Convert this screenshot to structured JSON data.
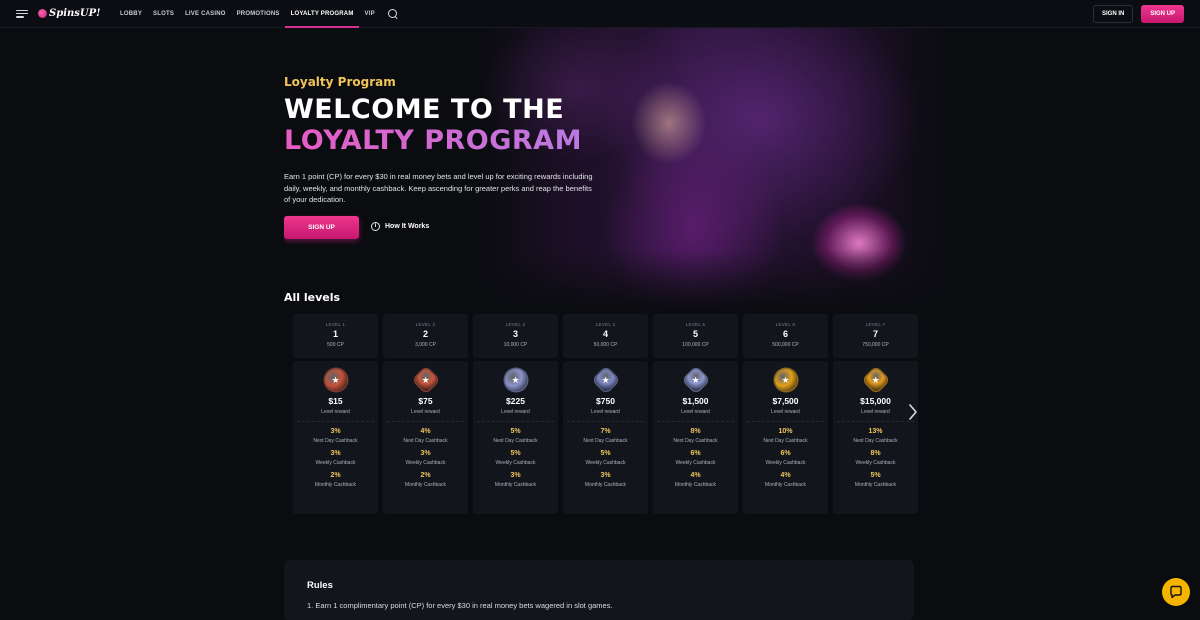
{
  "brand": {
    "name": "SpinsUP!"
  },
  "nav": {
    "items": [
      {
        "label": "LOBBY"
      },
      {
        "label": "SLOTS"
      },
      {
        "label": "LIVE CASINO"
      },
      {
        "label": "PROMOTIONS"
      },
      {
        "label": "LOYALTY PROGRAM",
        "active": true
      },
      {
        "label": "VIP"
      }
    ],
    "sign_in": "SIGN IN",
    "sign_up": "SIGN UP"
  },
  "hero": {
    "eyebrow": "Loyalty Program",
    "title_line1": "WELCOME TO THE",
    "title_line2": "LOYALTY PROGRAM",
    "description": "Earn 1 point (CP) for every $30 in real money bets and level up for exciting rewards including daily, weekly, and monthly cashback. Keep ascending for greater perks and reap the benefits of your dedication.",
    "cta": "SIGN UP",
    "how_it_works": "How It Works"
  },
  "levels": {
    "title": "All levels",
    "reward_label": "Level reward",
    "next_day_label": "Next Day Cashback",
    "weekly_label": "Weekly Cashback",
    "monthly_label": "Monthly Cashback",
    "items": [
      {
        "label": "LEVEL 1",
        "num": "1",
        "cp": "500 CP",
        "reward": "$15",
        "next_day": "3%",
        "weekly": "3%",
        "monthly": "2%",
        "medal_color": "#c4533a"
      },
      {
        "label": "LEVEL 2",
        "num": "2",
        "cp": "3,000 CP",
        "reward": "$75",
        "next_day": "4%",
        "weekly": "3%",
        "monthly": "2%",
        "medal_color": "#c8573c"
      },
      {
        "label": "LEVEL 3",
        "num": "3",
        "cp": "10,000 CP",
        "reward": "$225",
        "next_day": "5%",
        "weekly": "5%",
        "monthly": "3%",
        "medal_color": "#8c93c9"
      },
      {
        "label": "LEVEL 4",
        "num": "4",
        "cp": "50,000 CP",
        "reward": "$750",
        "next_day": "7%",
        "weekly": "5%",
        "monthly": "3%",
        "medal_color": "#7e89c6"
      },
      {
        "label": "LEVEL 5",
        "num": "5",
        "cp": "100,000 CP",
        "reward": "$1,500",
        "next_day": "8%",
        "weekly": "6%",
        "monthly": "4%",
        "medal_color": "#8f98d0"
      },
      {
        "label": "LEVEL 6",
        "num": "6",
        "cp": "500,000 CP",
        "reward": "$7,500",
        "next_day": "10%",
        "weekly": "6%",
        "monthly": "4%",
        "medal_color": "#e0a019"
      },
      {
        "label": "LEVEL 7",
        "num": "7",
        "cp": "750,000 CP",
        "reward": "$15,000",
        "next_day": "13%",
        "weekly": "8%",
        "monthly": "5%",
        "medal_color": "#e39c1c"
      }
    ]
  },
  "rules": {
    "title": "Rules",
    "line1": "1. Earn 1 complimentary point (CP) for every $30 in real money bets wagered in slot games."
  },
  "colors": {
    "accent": "#e0287f",
    "gold": "#f1c45a",
    "background": "#0a0c10",
    "card": "#12151c"
  }
}
